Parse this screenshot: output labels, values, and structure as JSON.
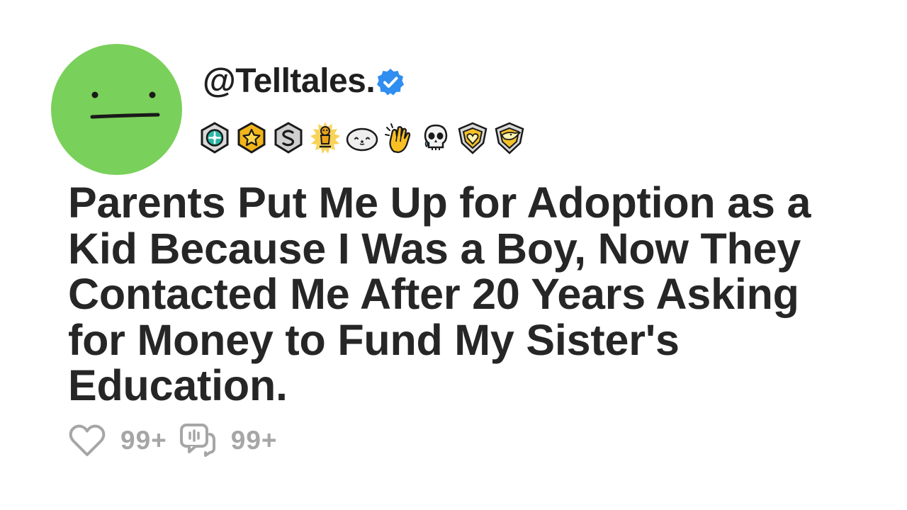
{
  "post": {
    "handle": "@Telltales.",
    "verified": true,
    "title": "Parents Put Me Up for Adoption as a Kid Because I Was a Boy, Now They Contacted Me After 20 Years Asking for Money to Fund My Sister's Education.",
    "likes_label": "99+",
    "comments_label": "99+"
  },
  "colors": {
    "avatar": "#79d05a",
    "verified": "#2f8ef0",
    "title_text": "#262626",
    "muted": "#a6a6a6"
  },
  "icons": {
    "avatar_face": "neutral-face-icon",
    "verified": "verified-check-icon",
    "like": "heart-icon",
    "comment": "comment-bubble-icon"
  },
  "badges": [
    {
      "name": "teal-medal-badge-icon"
    },
    {
      "name": "gold-star-badge-icon"
    },
    {
      "name": "silver-s-badge-icon"
    },
    {
      "name": "gold-trophy-badge-icon"
    },
    {
      "name": "seal-badge-icon"
    },
    {
      "name": "clapping-hands-badge-icon"
    },
    {
      "name": "crying-skull-badge-icon"
    },
    {
      "name": "gold-heart-shield-badge-icon"
    },
    {
      "name": "gold-bird-shield-badge-icon"
    }
  ]
}
